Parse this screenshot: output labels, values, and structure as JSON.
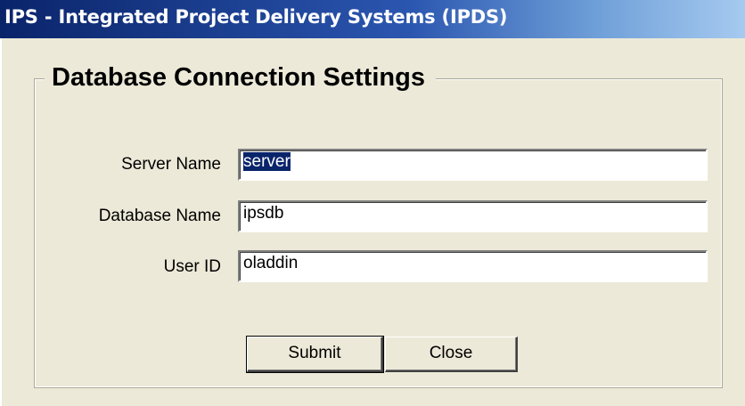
{
  "window": {
    "title": "IPS - Integrated Project Delivery Systems (IPDS)"
  },
  "group": {
    "title": "Database Connection Settings"
  },
  "fields": [
    {
      "label": "Server Name",
      "value": "server",
      "selected": true
    },
    {
      "label": "Database Name",
      "value": "ipsdb",
      "selected": false
    },
    {
      "label": "User ID",
      "value": "oladdin",
      "selected": false
    }
  ],
  "buttons": {
    "submit_label": "Submit",
    "close_label": "Close"
  },
  "colors": {
    "title_gradient_start": "#0a246a",
    "title_gradient_end": "#a6caf0",
    "dialog_background": "#ece9d8",
    "selection_highlight": "#0a246a"
  }
}
